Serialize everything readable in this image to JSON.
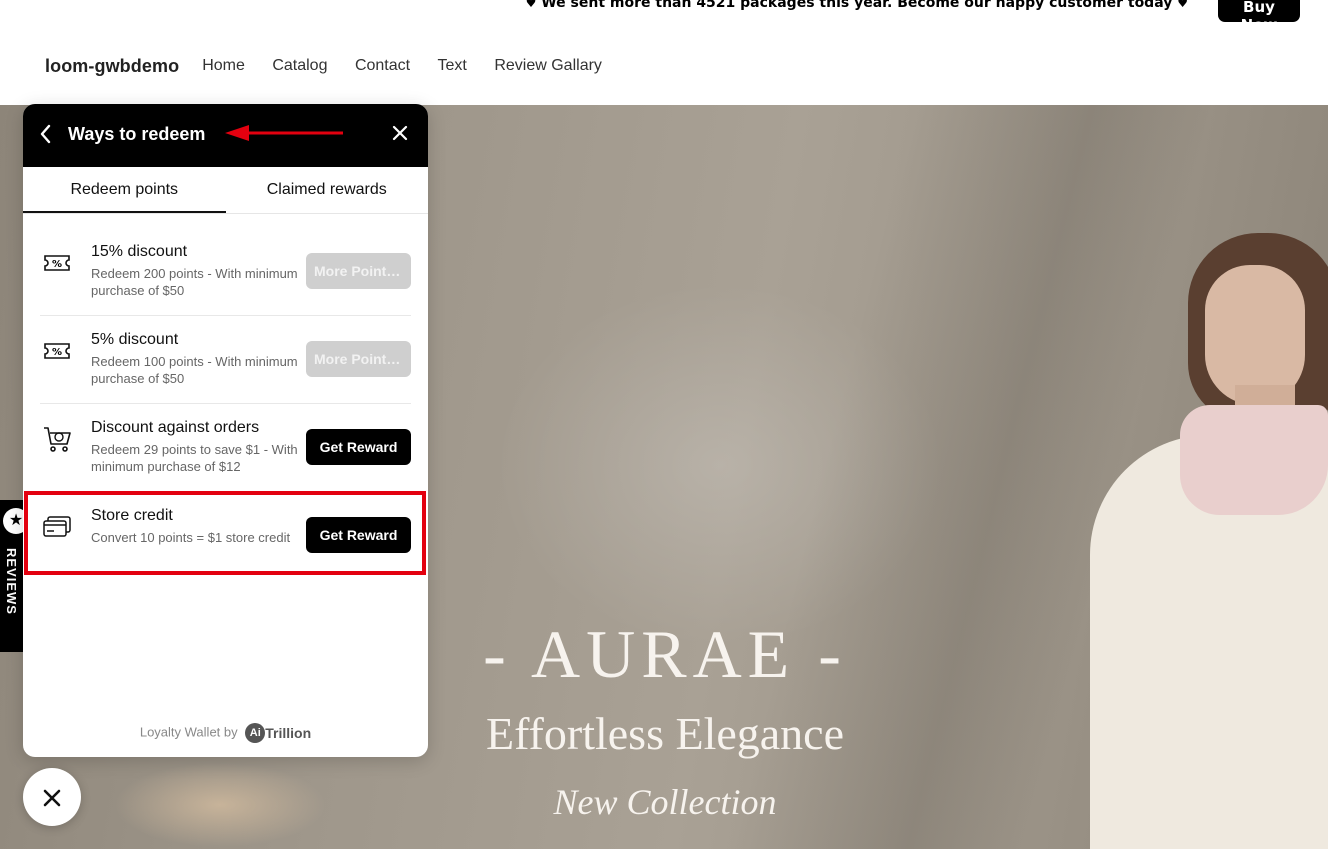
{
  "announcement": {
    "text": "We sent more than 4521 packages this year. Become our happy customer today",
    "cta": "Buy Now"
  },
  "header": {
    "brand": "loom-gwbdemo",
    "nav": [
      "Home",
      "Catalog",
      "Contact",
      "Text",
      "Review Gallary"
    ]
  },
  "hero": {
    "title": "- AURAE -",
    "tagline": "Effortless Elegance",
    "subtitle": "New Collection"
  },
  "reviews_tab": {
    "label": "REVIEWS"
  },
  "panel": {
    "title": "Ways to redeem",
    "tabs": [
      {
        "label": "Redeem points",
        "active": true
      },
      {
        "label": "Claimed rewards",
        "active": false
      }
    ],
    "rewards": [
      {
        "name": "15% discount",
        "desc": "Redeem 200 points - With minimum purchase of $50",
        "button": "More Points Needed",
        "enabled": false,
        "icon": "coupon-percent-icon"
      },
      {
        "name": "5% discount",
        "desc": "Redeem 100 points - With minimum purchase of $50",
        "button": "More Points Needed",
        "enabled": false,
        "icon": "coupon-percent-icon"
      },
      {
        "name": "Discount against orders",
        "desc": "Redeem 29 points to save $1 - With minimum purchase of $12",
        "button": "Get Reward",
        "enabled": true,
        "icon": "cart-discount-icon"
      },
      {
        "name": "Store credit",
        "desc": "Convert 10 points = $1 store credit",
        "button": "Get Reward",
        "enabled": true,
        "icon": "credit-card-icon"
      }
    ],
    "powered_by": "Loyalty Wallet by",
    "powered_logo_badge": "Ai",
    "powered_logo_text": "Trillion"
  },
  "colors": {
    "panel_header": "#000000",
    "highlight": "#e3000f",
    "button_disabled": "#cfcfcf",
    "button_active": "#000000"
  }
}
